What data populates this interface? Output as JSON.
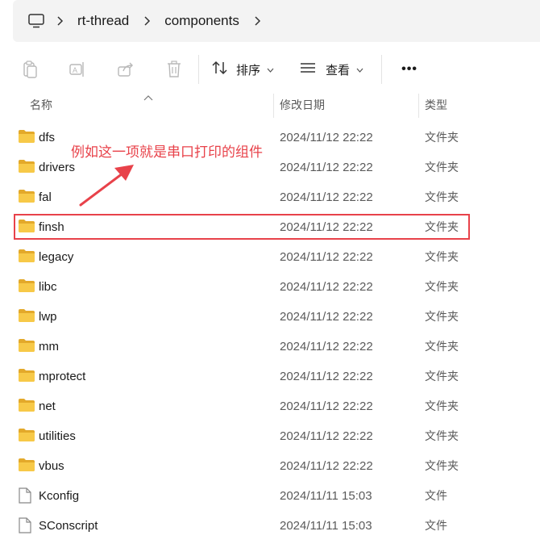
{
  "address_bar": {
    "crumbs": [
      "rt-thread",
      "components"
    ]
  },
  "toolbar": {
    "sort_label": "排序",
    "view_label": "查看",
    "more_label": "•••"
  },
  "columns": {
    "name": "名称",
    "date": "修改日期",
    "type": "类型"
  },
  "files": [
    {
      "name": "dfs",
      "date": "2024/11/12 22:22",
      "type": "文件夹",
      "icon": "folder-icon"
    },
    {
      "name": "drivers",
      "date": "2024/11/12 22:22",
      "type": "文件夹",
      "icon": "folder-icon"
    },
    {
      "name": "fal",
      "date": "2024/11/12 22:22",
      "type": "文件夹",
      "icon": "folder-icon"
    },
    {
      "name": "finsh",
      "date": "2024/11/12 22:22",
      "type": "文件夹",
      "icon": "folder-icon"
    },
    {
      "name": "legacy",
      "date": "2024/11/12 22:22",
      "type": "文件夹",
      "icon": "folder-icon"
    },
    {
      "name": "libc",
      "date": "2024/11/12 22:22",
      "type": "文件夹",
      "icon": "folder-icon"
    },
    {
      "name": "lwp",
      "date": "2024/11/12 22:22",
      "type": "文件夹",
      "icon": "folder-icon"
    },
    {
      "name": "mm",
      "date": "2024/11/12 22:22",
      "type": "文件夹",
      "icon": "folder-icon"
    },
    {
      "name": "mprotect",
      "date": "2024/11/12 22:22",
      "type": "文件夹",
      "icon": "folder-icon"
    },
    {
      "name": "net",
      "date": "2024/11/12 22:22",
      "type": "文件夹",
      "icon": "folder-icon"
    },
    {
      "name": "utilities",
      "date": "2024/11/12 22:22",
      "type": "文件夹",
      "icon": "folder-icon"
    },
    {
      "name": "vbus",
      "date": "2024/11/12 22:22",
      "type": "文件夹",
      "icon": "folder-icon"
    },
    {
      "name": "Kconfig",
      "date": "2024/11/11 15:03",
      "type": "文件",
      "icon": "file-icon"
    },
    {
      "name": "SConscript",
      "date": "2024/11/11 15:03",
      "type": "文件",
      "icon": "file-icon"
    }
  ],
  "annotation": {
    "text": "例如这一项就是串口打印的组件",
    "color": "#e8424a"
  },
  "colors": {
    "folder": "#f7c948",
    "folder_dark": "#e3a92a",
    "accent": "#e8424a"
  }
}
